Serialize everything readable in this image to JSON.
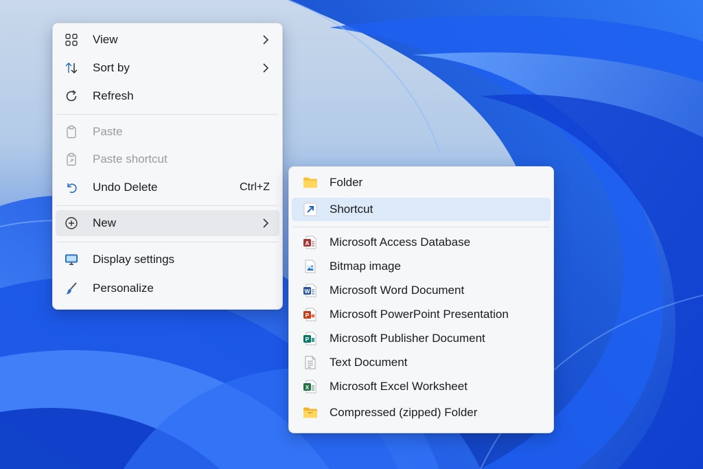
{
  "context_menu": {
    "items": [
      {
        "label": "View",
        "icon": "view-grid-icon",
        "has_submenu": true
      },
      {
        "label": "Sort by",
        "icon": "sort-icon",
        "has_submenu": true
      },
      {
        "label": "Refresh",
        "icon": "refresh-icon"
      },
      {
        "label": "Paste",
        "icon": "paste-icon",
        "disabled": true
      },
      {
        "label": "Paste shortcut",
        "icon": "paste-shortcut-icon",
        "disabled": true
      },
      {
        "label": "Undo Delete",
        "icon": "undo-icon",
        "shortcut": "Ctrl+Z"
      },
      {
        "label": "New",
        "icon": "new-plus-icon",
        "has_submenu": true,
        "highlighted": true
      },
      {
        "label": "Display settings",
        "icon": "display-icon"
      },
      {
        "label": "Personalize",
        "icon": "brush-icon"
      }
    ]
  },
  "new_submenu": {
    "items": [
      {
        "label": "Folder",
        "icon": "folder-icon"
      },
      {
        "label": "Shortcut",
        "icon": "shortcut-arrow-icon",
        "highlighted": true
      },
      {
        "label": "Microsoft Access Database",
        "icon": "access-icon",
        "color": "#a4373a"
      },
      {
        "label": "Bitmap image",
        "icon": "bitmap-icon",
        "color": "#2b6fc4"
      },
      {
        "label": "Microsoft Word Document",
        "icon": "word-icon",
        "color": "#2b579a"
      },
      {
        "label": "Microsoft PowerPoint Presentation",
        "icon": "powerpoint-icon",
        "color": "#c43e1c"
      },
      {
        "label": "Microsoft Publisher Document",
        "icon": "publisher-icon",
        "color": "#077568"
      },
      {
        "label": "Text Document",
        "icon": "text-document-icon"
      },
      {
        "label": "Microsoft Excel Worksheet",
        "icon": "excel-icon",
        "color": "#217346"
      },
      {
        "label": "Compressed (zipped) Folder",
        "icon": "zip-folder-icon"
      }
    ]
  },
  "colors": {
    "menu_background": "#f6f7f9",
    "selected_background": "#dce9f8",
    "hover_background": "#e6e8ec",
    "wallpaper_blue": "#1e5fe0"
  }
}
